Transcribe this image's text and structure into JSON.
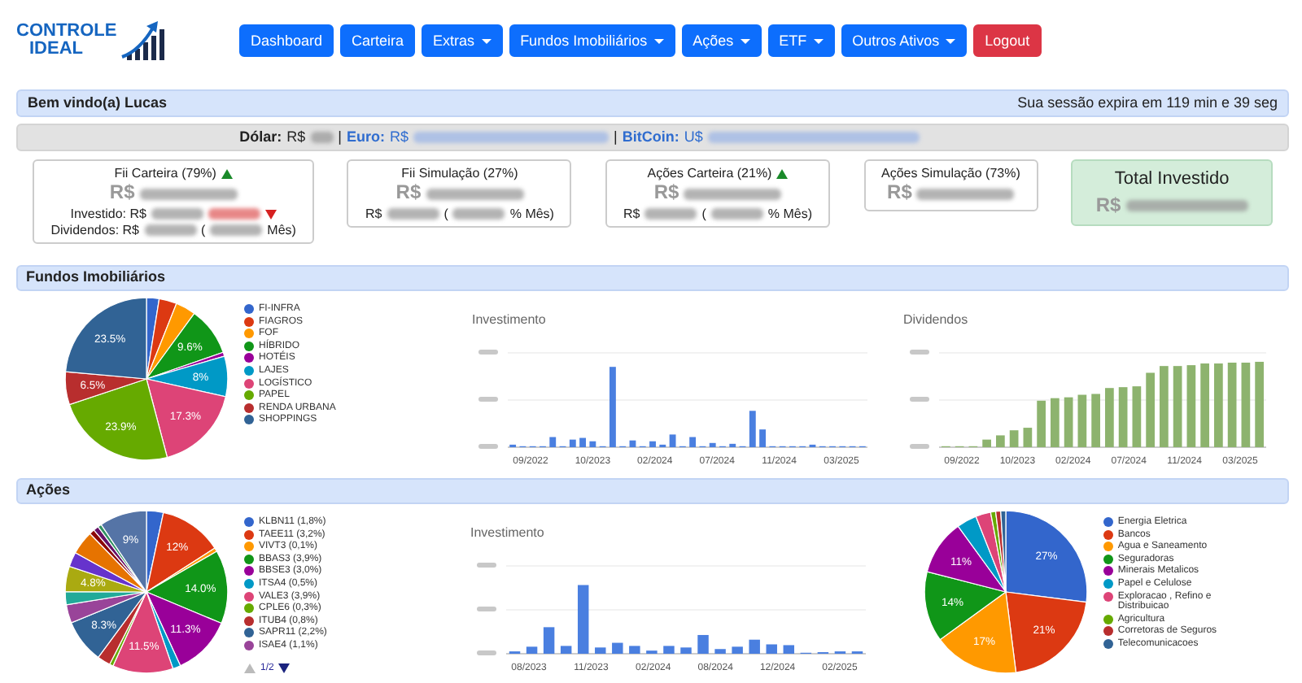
{
  "logo": {
    "line1": "CONTROLE",
    "line2": "IDEAL"
  },
  "nav": [
    {
      "label": "Dashboard",
      "kind": "link"
    },
    {
      "label": "Carteira",
      "kind": "link"
    },
    {
      "label": "Extras",
      "kind": "dropdown"
    },
    {
      "label": "Fundos Imobiliários",
      "kind": "dropdown"
    },
    {
      "label": "Ações",
      "kind": "dropdown"
    },
    {
      "label": "ETF",
      "kind": "dropdown"
    },
    {
      "label": "Outros Ativos",
      "kind": "dropdown"
    },
    {
      "label": "Logout",
      "kind": "logout"
    }
  ],
  "welcome": {
    "greeting": "Bem vindo(a) Lucas",
    "session": "Sua sessão expira em 119 min e 39 seg"
  },
  "rates": [
    {
      "kind": "label",
      "text": "Dólar:"
    },
    {
      "kind": "text",
      "text": "R$"
    },
    {
      "kind": "blur"
    },
    {
      "kind": "text",
      "text": "|"
    },
    {
      "kind": "link-label",
      "text": "Euro:"
    },
    {
      "kind": "link-text",
      "text": "R$"
    },
    {
      "kind": "link-blur"
    },
    {
      "kind": "text",
      "text": "|"
    },
    {
      "kind": "link-label",
      "text": "BitCoin:"
    },
    {
      "kind": "link-text",
      "text": "U$"
    },
    {
      "kind": "link-blur"
    }
  ],
  "cards": [
    {
      "highlight": false,
      "title": [
        {
          "kind": "text",
          "text": "Fii Carteira (79%)"
        },
        {
          "kind": "up-arrow"
        }
      ],
      "value": [
        {
          "kind": "text",
          "text": "R$"
        },
        {
          "kind": "blur"
        }
      ],
      "details": [
        [
          {
            "kind": "text",
            "text": "Investido: R$"
          },
          {
            "kind": "blur"
          },
          {
            "kind": "negative-blur"
          },
          {
            "kind": "down-arrow"
          }
        ],
        [
          {
            "kind": "text",
            "text": "Dividendos: R$"
          },
          {
            "kind": "blur"
          },
          {
            "kind": "text",
            "text": "("
          },
          {
            "kind": "blur"
          },
          {
            "kind": "text",
            "text": "Mês)"
          }
        ]
      ]
    },
    {
      "highlight": false,
      "title": [
        {
          "kind": "text",
          "text": "Fii Simulação (27%)"
        }
      ],
      "value": [
        {
          "kind": "text",
          "text": "R$"
        },
        {
          "kind": "blur"
        }
      ],
      "details": [
        [
          {
            "kind": "text",
            "text": "R$"
          },
          {
            "kind": "blur"
          },
          {
            "kind": "text",
            "text": "("
          },
          {
            "kind": "blur"
          },
          {
            "kind": "text",
            "text": "% Mês)"
          }
        ]
      ]
    },
    {
      "highlight": false,
      "title": [
        {
          "kind": "text",
          "text": "Ações Carteira (21%)"
        },
        {
          "kind": "up-arrow"
        }
      ],
      "value": [
        {
          "kind": "text",
          "text": "R$"
        },
        {
          "kind": "blur"
        }
      ],
      "details": [
        [
          {
            "kind": "text",
            "text": "R$"
          },
          {
            "kind": "blur"
          },
          {
            "kind": "text",
            "text": "("
          },
          {
            "kind": "blur"
          },
          {
            "kind": "text",
            "text": "% Mês)"
          }
        ]
      ]
    },
    {
      "highlight": false,
      "title": [
        {
          "kind": "text",
          "text": "Ações Simulação (73%)"
        }
      ],
      "value": [
        {
          "kind": "text",
          "text": "R$"
        },
        {
          "kind": "blur"
        }
      ]
    },
    {
      "highlight": true,
      "title": [
        {
          "kind": "text",
          "text": "Total Investido"
        }
      ],
      "value": [
        {
          "kind": "text",
          "text": "R$"
        },
        {
          "kind": "blur"
        }
      ]
    }
  ],
  "sections": [
    {
      "title": "Fundos Imobiliários",
      "charts": [
        {
          "kind": "pie",
          "chart_data": {
            "type": "pie",
            "legend": "right",
            "categories": [
              "FI-INFRA",
              "FIAGROS",
              "FOF",
              "HÍBRIDO",
              "HOTÉIS",
              "LAJES",
              "LOGÍSTICO",
              "PAPEL",
              "RENDA URBANA",
              "SHOPPINGS"
            ],
            "values": [
              2.5,
              3.5,
              4,
              9.6,
              0.8,
              8,
              17.3,
              23.9,
              6.5,
              23.5
            ],
            "colors": [
              "#3366cc",
              "#dc3912",
              "#ff9900",
              "#109618",
              "#990099",
              "#0099c6",
              "#dd4477",
              "#66aa00",
              "#b82e2e",
              "#316395"
            ],
            "value_labels": [
              null,
              null,
              null,
              "9.6%",
              null,
              "8%",
              "17.3%",
              "23.9%",
              "6.5%",
              "23.5%"
            ]
          }
        },
        {
          "kind": "bars",
          "title": "Investimento",
          "color": "#4a7fe0",
          "x_labels": [
            "09/2022",
            "10/2023",
            "02/2024",
            "07/2024",
            "11/2024",
            "03/2025"
          ]
        },
        {
          "kind": "bars",
          "title": "Dividendos",
          "color": "#8db36e",
          "x_labels": [
            "09/2022",
            "10/2023",
            "02/2024",
            "07/2024",
            "11/2024",
            "03/2025"
          ]
        }
      ]
    },
    {
      "title": "Ações",
      "charts": [
        {
          "kind": "pie",
          "chart_data": {
            "type": "pie",
            "legend": "right",
            "categories": [
              "KLBN11 (1,8%)",
              "TAEE11 (3,2%)",
              "VIVT3 (0,1%)",
              "BBAS3 (3,9%)",
              "BBSE3 (3,0%)",
              "ITSA4 (0,5%)",
              "VALE3 (3,9%)",
              "CPLE6 (0,3%)",
              "ITUB4 (0,8%)",
              "SAPR11 (2,2%)",
              "ISAE4 (1,1%)",
              null,
              null,
              null,
              null,
              null,
              null,
              null,
              null
            ],
            "values": [
              3.2,
              12,
              0.7,
              14,
              11.3,
              1.5,
              11.5,
              0.7,
              2.5,
              8.3,
              3.5,
              2.5,
              4.8,
              2.8,
              4.5,
              1,
              1,
              0.7,
              9
            ],
            "colors": [
              "#3366cc",
              "#dc3912",
              "#ff9900",
              "#109618",
              "#990099",
              "#0099c6",
              "#dd4477",
              "#66aa00",
              "#b82e2e",
              "#316395",
              "#994499",
              "#22aa99",
              "#aaaa11",
              "#6633cc",
              "#e67300",
              "#8b0707",
              "#651067",
              "#329262",
              "#5574a6"
            ],
            "value_labels": [
              null,
              "12%",
              null,
              "14.0%",
              "11.3%",
              null,
              "11.5%",
              null,
              null,
              "8.3%",
              null,
              null,
              "4.8%",
              null,
              null,
              null,
              null,
              null,
              "9%"
            ]
          },
          "pager": {
            "text": "1/2",
            "prev_disabled": true,
            "next_disabled": false
          }
        },
        {
          "kind": "bars",
          "title": "Investimento",
          "color": "#4a7fe0",
          "x_labels": [
            "08/2023",
            "11/2023",
            "02/2024",
            "08/2024",
            "12/2024",
            "02/2025"
          ]
        },
        {
          "kind": "pie",
          "chart_data": {
            "type": "pie",
            "legend": "right",
            "categories": [
              "Energia Eletrica",
              "Bancos",
              "Agua e Saneamento",
              "Seguradoras",
              "Minerais Metalicos",
              "Papel e Celulose",
              "Exploracao , Refino e Distribuicao",
              "Agricultura",
              "Corretoras de Seguros",
              "Telecomunicacoes"
            ],
            "values": [
              27,
              21,
              17,
              14,
              11,
              4,
              3,
              1,
              1,
              1
            ],
            "colors": [
              "#3366cc",
              "#dc3912",
              "#ff9900",
              "#109618",
              "#990099",
              "#0099c6",
              "#dd4477",
              "#66aa00",
              "#b82e2e",
              "#316395"
            ],
            "value_labels": [
              "27%",
              "21%",
              "17%",
              "14%",
              "11%",
              null,
              null,
              null,
              null,
              null
            ]
          }
        }
      ]
    }
  ]
}
